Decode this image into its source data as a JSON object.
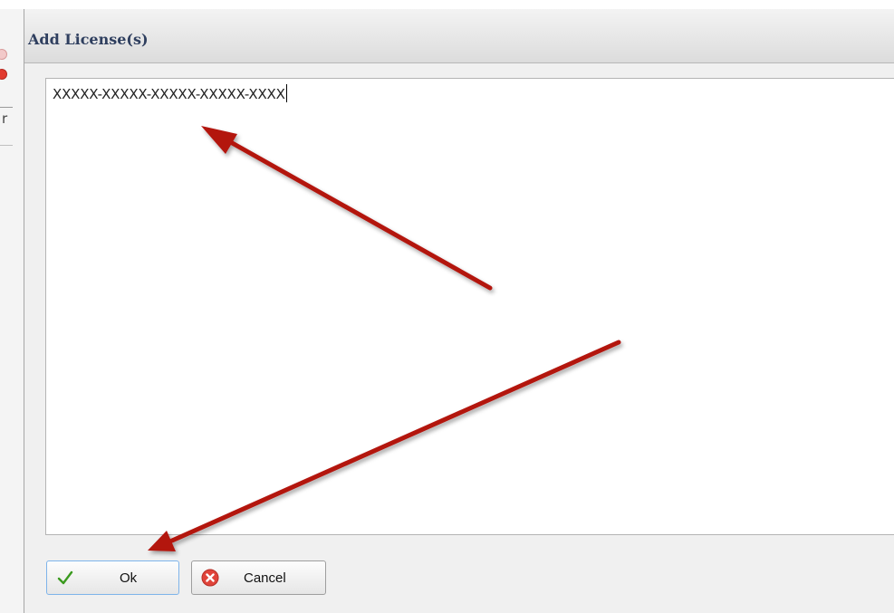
{
  "dialog": {
    "title": "Add License(s)",
    "license_value": "XXXXX-XXXXX-XXXXX-XXXXX-XXXX"
  },
  "buttons": {
    "ok_label": "Ok",
    "ok_icon": "checkmark-icon",
    "cancel_label": "Cancel",
    "cancel_icon": "close-circle-icon"
  },
  "background_window": {
    "tab_glyph": "r"
  },
  "colors": {
    "title_text": "#2f3f5f",
    "ok_check": "#3a9a1e",
    "cancel_icon": "#e0443a",
    "annotation_arrow": "#b3120f"
  }
}
